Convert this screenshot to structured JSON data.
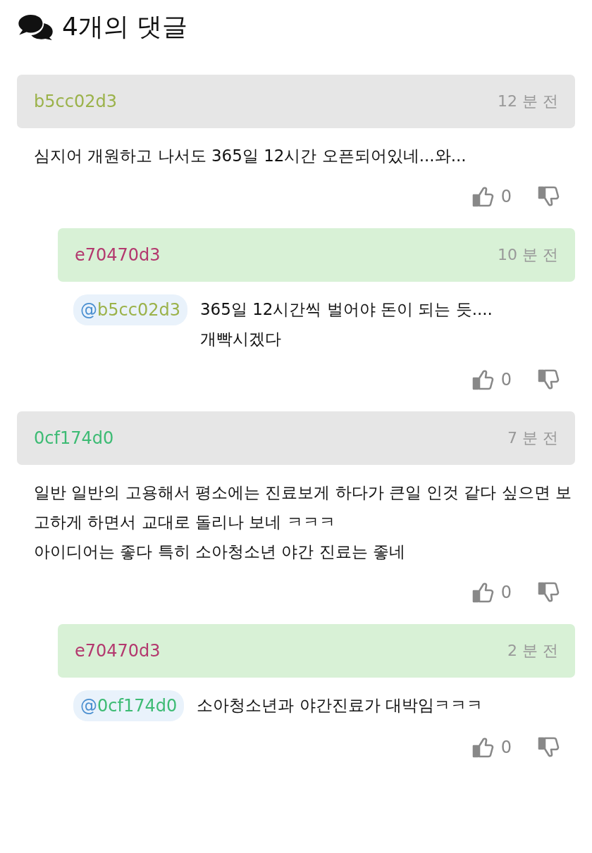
{
  "title": "4개의 댓글",
  "comments": [
    {
      "kind": "comment",
      "author": "b5cc02d3",
      "color": "#9bb24a",
      "time": "12 분 전",
      "text": "심지어 개원하고 나서도 365일 12시간 오픈되어있네...와...",
      "likes": "0"
    },
    {
      "kind": "reply",
      "author": "e70470d3",
      "color": "#b3386e",
      "time": "10 분 전",
      "mention": {
        "text": "@b5cc02d3",
        "color": "#9bb24a"
      },
      "text": "365일 12시간씩 벌어야 돈이 되는 듯....\n개빡시겠다",
      "likes": "0"
    },
    {
      "kind": "comment",
      "author": "0cf174d0",
      "color": "#3dbb74",
      "time": "7 분 전",
      "text": "일반 일반의 고용해서 평소에는 진료보게 하다가 큰일 인것 같다 싶으면 보고하게 하면서 교대로 돌리나 보네 ㅋㅋㅋ\n아이디어는 좋다 특히 소아청소년 야간 진료는 좋네",
      "likes": "0"
    },
    {
      "kind": "reply",
      "author": "e70470d3",
      "color": "#b3386e",
      "time": "2 분 전",
      "mention": {
        "text": "@0cf174d0",
        "color": "#3dbb74"
      },
      "text": "소아청소년과 야간진료가 대박임ㅋㅋㅋ",
      "likes": "0"
    }
  ]
}
